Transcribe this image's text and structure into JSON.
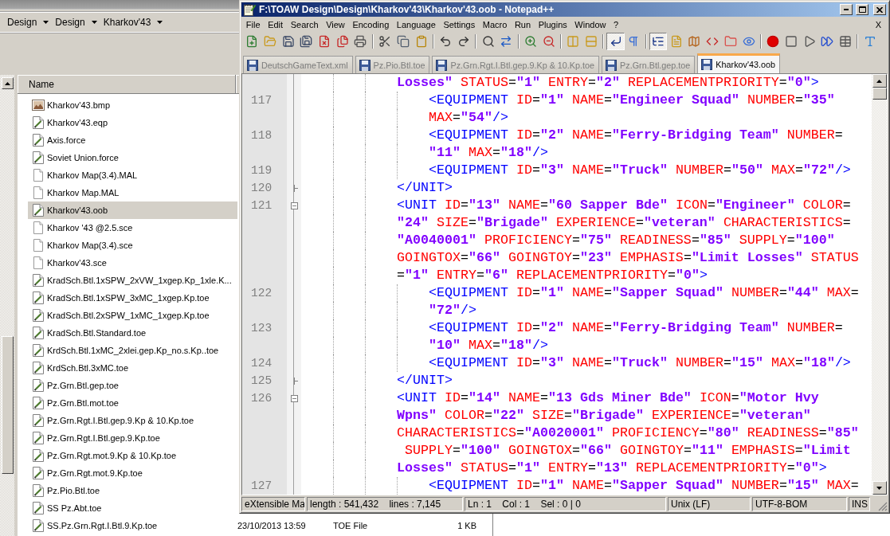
{
  "explorer": {
    "breadcrumbs": [
      "Design",
      "Design",
      "Kharkov'43"
    ],
    "columns": [
      "Name"
    ],
    "files": [
      {
        "name": "Kharkov'43.bmp",
        "kind": "image",
        "selected": false
      },
      {
        "name": "Kharkov'43.eqp",
        "kind": "edit",
        "selected": false
      },
      {
        "name": "Axis.force",
        "kind": "edit",
        "selected": false
      },
      {
        "name": "Soviet Union.force",
        "kind": "edit",
        "selected": false
      },
      {
        "name": "Kharkov Map(3.4).MAL",
        "kind": "blank",
        "selected": false
      },
      {
        "name": "Kharkov Map.MAL",
        "kind": "blank",
        "selected": false
      },
      {
        "name": "Kharkov'43.oob",
        "kind": "edit",
        "selected": true
      },
      {
        "name": "Kharkov '43 @2.5.sce",
        "kind": "blank",
        "selected": false
      },
      {
        "name": "Kharkov Map(3.4).sce",
        "kind": "blank",
        "selected": false
      },
      {
        "name": "Kharkov'43.sce",
        "kind": "blank",
        "selected": false
      },
      {
        "name": "KradSch.Btl.1xSPW_2xVW_1xgep.Kp_1xle.K...",
        "kind": "edit",
        "selected": false
      },
      {
        "name": "KradSch.Btl.1xSPW_3xMC_1xgep.Kp.toe",
        "kind": "edit",
        "selected": false
      },
      {
        "name": "KradSch.Btl.2xSPW_1xMC_1xgep.Kp.toe",
        "kind": "edit",
        "selected": false
      },
      {
        "name": "KradSch.Btl.Standard.toe",
        "kind": "edit",
        "selected": false
      },
      {
        "name": "KrdSch.Btl.1xMC_2xlei.gep.Kp_no.s.Kp..toe",
        "kind": "edit",
        "selected": false
      },
      {
        "name": "KrdSch.Btl.3xMC.toe",
        "kind": "edit",
        "selected": false
      },
      {
        "name": "Pz.Grn.Btl.gep.toe",
        "kind": "edit",
        "selected": false
      },
      {
        "name": "Pz.Grn.Btl.mot.toe",
        "kind": "edit",
        "selected": false
      },
      {
        "name": "Pz.Grn.Rgt.I.Btl.gep.9.Kp & 10.Kp.toe",
        "kind": "edit",
        "selected": false
      },
      {
        "name": "Pz.Grn.Rgt.I.Btl.gep.9.Kp.toe",
        "kind": "edit",
        "selected": false
      },
      {
        "name": "Pz.Grn.Rgt.mot.9.Kp & 10.Kp.toe",
        "kind": "edit",
        "selected": false
      },
      {
        "name": "Pz.Grn.Rgt.mot.9.Kp.toe",
        "kind": "edit",
        "selected": false
      },
      {
        "name": "Pz.Pio.Btl.toe",
        "kind": "edit",
        "selected": false
      },
      {
        "name": "SS Pz.Abt.toe",
        "kind": "edit",
        "selected": false
      },
      {
        "name": "SS.Pz.Grn.Rgt.I.Btl.9.Kp.toe",
        "kind": "edit",
        "selected": false,
        "date": "23/10/2013 13:59",
        "type": "TOE File",
        "size": "1 KB"
      }
    ]
  },
  "notepad": {
    "title": "F:\\TOAW Design\\Design\\Kharkov'43\\Kharkov'43.oob - Notepad++",
    "menu": [
      "File",
      "Edit",
      "Search",
      "View",
      "Encoding",
      "Language",
      "Settings",
      "Macro",
      "Run",
      "Plugins",
      "Window",
      "?"
    ],
    "close_document": "X",
    "toolbar": [
      [
        {
          "pressed": false
        },
        {
          "pressed": false
        },
        {
          "pressed": false
        },
        {
          "pressed": false
        },
        {
          "pressed": false
        },
        {
          "pressed": false
        },
        {
          "pressed": false
        }
      ],
      [
        {
          "pressed": false
        },
        {
          "pressed": false
        },
        {
          "pressed": false
        }
      ],
      [
        {
          "pressed": false
        },
        {
          "pressed": false
        }
      ],
      [
        {
          "pressed": false
        },
        {
          "pressed": false
        }
      ],
      [
        {
          "pressed": false
        },
        {
          "pressed": false
        }
      ],
      [
        {
          "pressed": false
        },
        {
          "pressed": false
        }
      ],
      [
        {
          "pressed": true
        },
        {
          "pressed": false
        }
      ],
      [
        {
          "pressed": true
        },
        {
          "pressed": false
        },
        {
          "pressed": false
        },
        {
          "pressed": false
        },
        {
          "pressed": false
        },
        {
          "pressed": false
        }
      ],
      [
        {
          "pressed": false
        },
        {
          "pressed": false
        },
        {
          "pressed": false
        },
        {
          "pressed": false
        },
        {
          "pressed": false
        }
      ],
      [
        {
          "pressed": false
        }
      ]
    ],
    "tabs": [
      {
        "label": "DeutschGameText.xml",
        "selected": false
      },
      {
        "label": "Pz.Pio.Btl.toe",
        "selected": false
      },
      {
        "label": "Pz.Grn.Rgt.I.Btl.gep.9.Kp & 10.Kp.toe",
        "selected": false
      },
      {
        "label": "Pz.Grn.Btl.gep.toe",
        "selected": false
      },
      {
        "label": "Kharkov'43.oob",
        "selected": true
      }
    ],
    "lines": [
      {
        "rows": [
          "Losses\" STATUS=\"1\" ENTRY=\"2\" REPLACEMENTPRIORITY=\"0\">"
        ],
        "children": [
          {
            "number": "117",
            "rows": [
              "<EQUIPMENT ID=\"1\" NAME=\"Engineer Squad\" NUMBER=\"35\"",
              "MAX=\"54\"/>"
            ]
          },
          {
            "number": "118",
            "rows": [
              "<EQUIPMENT ID=\"2\" NAME=\"Ferry-Bridging Team\" NUMBER=",
              "\"11\" MAX=\"18\"/>"
            ]
          },
          {
            "number": "119",
            "rows": [
              "<EQUIPMENT ID=\"3\" NAME=\"Truck\" NUMBER=\"50\" MAX=\"72\"/>"
            ]
          }
        ]
      },
      {
        "number": "120",
        "fold_end": true,
        "rows": [
          "</UNIT>"
        ]
      },
      {
        "number": "121",
        "expanded": true,
        "rows": [
          "<UNIT ID=\"13\" NAME=\"60 Sapper Bde\" ICON=\"Engineer\" COLOR=",
          "\"24\" SIZE=\"Brigade\" EXPERIENCE=\"veteran\" CHARACTERISTICS=",
          "\"A0040001\" PROFICIENCY=\"75\" READINESS=\"85\" SUPPLY=\"100\"",
          "GOINGTOX=\"66\" GOINGTOY=\"23\" EMPHASIS=\"Limit Losses\" STATUS",
          "=\"1\" ENTRY=\"6\" REPLACEMENTPRIORITY=\"0\">"
        ],
        "children": [
          {
            "number": "122",
            "rows": [
              "<EQUIPMENT ID=\"1\" NAME=\"Sapper Squad\" NUMBER=\"44\" MAX=",
              "\"72\"/>"
            ]
          },
          {
            "number": "123",
            "rows": [
              "<EQUIPMENT ID=\"2\" NAME=\"Ferry-Bridging Team\" NUMBER=",
              "\"10\" MAX=\"18\"/>"
            ]
          },
          {
            "number": "124",
            "rows": [
              "<EQUIPMENT ID=\"3\" NAME=\"Truck\" NUMBER=\"15\" MAX=\"18\"/>"
            ]
          }
        ]
      },
      {
        "number": "125",
        "fold_end": true,
        "rows": [
          "</UNIT>"
        ]
      },
      {
        "number": "126",
        "expanded": true,
        "rows": [
          "<UNIT ID=\"14\" NAME=\"13 Gds Miner Bde\" ICON=\"Motor Hvy",
          "Wpns\" COLOR=\"22\" SIZE=\"Brigade\" EXPERIENCE=\"veteran\"",
          "CHARACTERISTICS=\"A0020001\" PROFICIENCY=\"80\" READINESS=\"85\"",
          " SUPPLY=\"100\" GOINGTOX=\"66\" GOINGTOY=\"11\" EMPHASIS=\"Limit",
          "Losses\" STATUS=\"1\" ENTRY=\"13\" REPLACEMENTPRIORITY=\"0\">"
        ],
        "children": [
          {
            "number": "127",
            "rows": [
              "<EQUIPMENT ID=\"1\" NAME=\"Sapper Squad\" NUMBER=\"15\" MAX="
            ]
          }
        ]
      }
    ],
    "status_bar": [
      "eXtensible Ma",
      "length : 541,432    lines : 7,145",
      "Ln : 1    Col : 1    Sel : 0 | 0",
      "Unix (LF)",
      "UTF-8-BOM",
      "INS"
    ]
  }
}
